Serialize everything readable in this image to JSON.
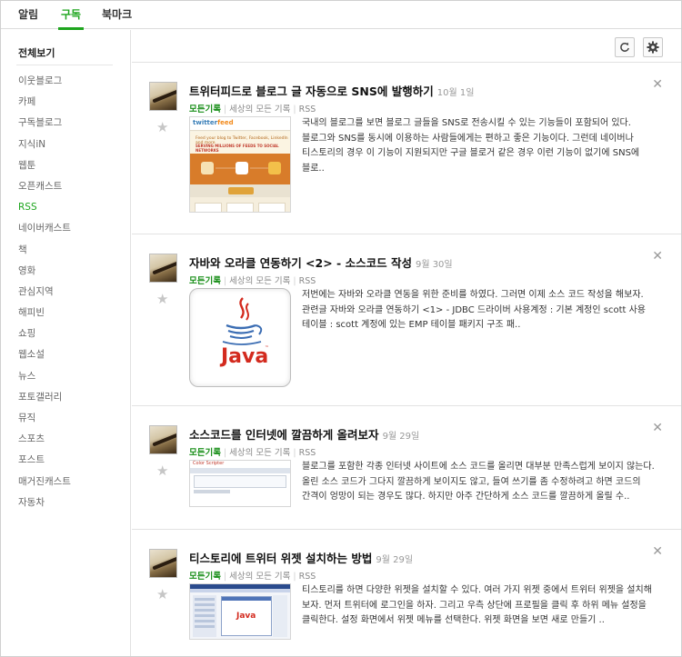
{
  "top_tabs": [
    {
      "label": "알림",
      "active": false
    },
    {
      "label": "구독",
      "active": true
    },
    {
      "label": "북마크",
      "active": false
    }
  ],
  "sidebar": {
    "all_label": "전체보기",
    "items": [
      {
        "label": "이웃블로그"
      },
      {
        "label": "카페"
      },
      {
        "label": "구독블로그"
      },
      {
        "label": "지식iN"
      },
      {
        "label": "웹툰"
      },
      {
        "label": "오픈캐스트"
      },
      {
        "label": "RSS",
        "active": true
      },
      {
        "label": "네이버캐스트"
      },
      {
        "label": "책"
      },
      {
        "label": "영화"
      },
      {
        "label": "관심지역"
      },
      {
        "label": "해피빈"
      },
      {
        "label": "쇼핑"
      },
      {
        "label": "웹소설"
      },
      {
        "label": "뉴스"
      },
      {
        "label": "포토갤러리"
      },
      {
        "label": "뮤직"
      },
      {
        "label": "스포츠"
      },
      {
        "label": "포스트"
      },
      {
        "label": "매거진캐스트"
      },
      {
        "label": "자동차"
      }
    ]
  },
  "toolbar": {
    "refresh_icon": "refresh-icon",
    "settings_icon": "gear-icon"
  },
  "colors": {
    "accent": "#1ea51e",
    "category": "#1a8f1a",
    "star": "#c6c6c6"
  },
  "feed": [
    {
      "title": "트위터피드로 블로그 글 자동으로 SNS에 발행하기",
      "date": "10월 1일",
      "category": "모든기록",
      "source": "세상의 모든 기록",
      "feed_type": "RSS",
      "thumb_kind": "twitterfeed",
      "thumb_text": {
        "logo_a": "twitter",
        "logo_b": "feed",
        "tagline": "Feed your blog to Twitter, Facebook, LinkedIn and more",
        "headline": "SERVING MILLIONS OF FEEDS TO SOCIAL NETWORKS"
      },
      "excerpt": "국내의 블로그를 보면 블로그 글들을 SNS로 전송시킬 수 있는 기능들이 포함되어 있다. 블로그와 SNS를 동시에 이용하는 사람들에게는 편하고 좋은 기능이다. 그런데 네이버나 티스토리의 경우 이 기능이 지원되지만 구글 블로거 같은 경우 이런 기능이 없기에 SNS에 블로.."
    },
    {
      "title": "자바와 오라클 연동하기 <2> - 소스코드 작성",
      "date": "9월 30일",
      "category": "모든기록",
      "source": "세상의 모든 기록",
      "feed_type": "RSS",
      "thumb_kind": "java",
      "thumb_text": {
        "word": "Java",
        "tm": "™"
      },
      "excerpt": "저번에는 자바와 오라클 연동을 위한 준비를 하였다. 그러면 이제 소스 코드 작성을 해보자. 관련글 자바와 오라클 연동하기 <1> - JDBC 드라이버 사용계정 : 기본 계정인 scott 사용 테이블 : scott 계정에 있는 EMP 테이블 패키지 구조 패.."
    },
    {
      "title": "소스코드를 인터넷에 깔끔하게 올려보자",
      "date": "9월 29일",
      "category": "모든기록",
      "source": "세상의 모든 기록",
      "feed_type": "RSS",
      "thumb_kind": "color-scripter",
      "thumb_text": {
        "title": "Color Scripter"
      },
      "excerpt": "블로그를 포함한 각종 인터넷 사이트에 소스 코드를 올리면 대부분 만족스럽게 보이지 않는다. 올린 소스 코드가 그다지 깔끔하게 보이지도 않고, 들여 쓰기를 좀 수정하려고 하면 코드의 간격이 엉망이 되는 경우도 많다.  하지만 아주 간단하게 소스 코드를 깔끔하게 올릴 수.."
    },
    {
      "title": "티스토리에 트위터 위젯 설치하는 방법",
      "date": "9월 29일",
      "category": "모든기록",
      "source": "세상의 모든 기록",
      "feed_type": "RSS",
      "thumb_kind": "screenshot",
      "thumb_text": {
        "word": "Java"
      },
      "excerpt": "티스토리를 하면 다양한 위젯을 설치할 수 있다. 여러 가지 위젯 중에서 트위터 위젯을 설치해 보자.  먼저 트위터에 로그인을 하자. 그리고 우측 상단에 프로필을 클릭 후 하위 메뉴 설정을 클릭한다. 설정 화면에서 위젯 메뉴를 선택한다. 위젯 화면을 보면 새로 만들기 .."
    }
  ]
}
